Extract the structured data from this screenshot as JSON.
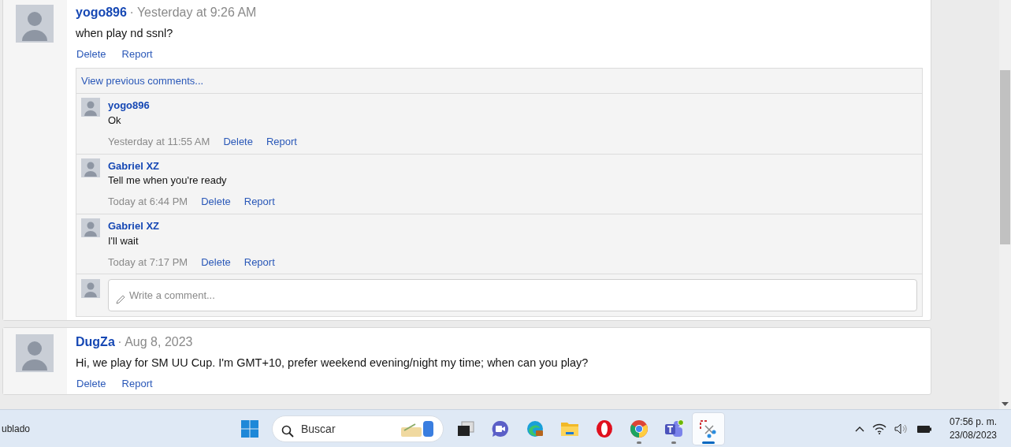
{
  "posts": [
    {
      "author": "yogo896",
      "time": "· Yesterday at 9:26 AM",
      "text": "when play nd ssnl?",
      "actions": [
        "Delete",
        "Report"
      ],
      "thread": {
        "more_link": "View previous comments...",
        "comments": [
          {
            "author": "yogo896",
            "text": "Ok",
            "time": "Yesterday at 11:55 AM",
            "actions": [
              "Delete",
              "Report"
            ]
          },
          {
            "author": "Gabriel XZ",
            "text": "Tell me when you're ready",
            "time": "Today at 6:44 PM",
            "actions": [
              "Delete",
              "Report"
            ]
          },
          {
            "author": "Gabriel XZ",
            "text": "I'll wait",
            "time": "Today at 7:17 PM",
            "actions": [
              "Delete",
              "Report"
            ]
          }
        ],
        "composer": {
          "placeholder": "Write a comment..."
        }
      }
    },
    {
      "author": "DugZa",
      "time": "· Aug 8, 2023",
      "text": "Hi, we play for SM UU Cup. I'm GMT+10, prefer weekend evening/night my time; when can you play?",
      "actions": [
        "Delete",
        "Report"
      ]
    }
  ],
  "taskbar": {
    "weather": "ublado",
    "search": {
      "placeholder": "Buscar"
    },
    "apps": [
      {
        "kind": "start",
        "running": false,
        "selected": false
      },
      {
        "kind": "task-view",
        "running": false,
        "selected": false
      },
      {
        "kind": "chat",
        "running": false,
        "selected": false
      },
      {
        "kind": "edge",
        "running": false,
        "selected": false
      },
      {
        "kind": "folder",
        "running": false,
        "selected": false
      },
      {
        "kind": "opera",
        "running": false,
        "selected": false
      },
      {
        "kind": "chrome",
        "running": true,
        "selected": false
      },
      {
        "kind": "teams",
        "running": true,
        "selected": false
      },
      {
        "kind": "snip",
        "running": true,
        "selected": true
      }
    ],
    "clock": {
      "time": "07:56 p. m.",
      "date": "23/08/2023"
    }
  }
}
